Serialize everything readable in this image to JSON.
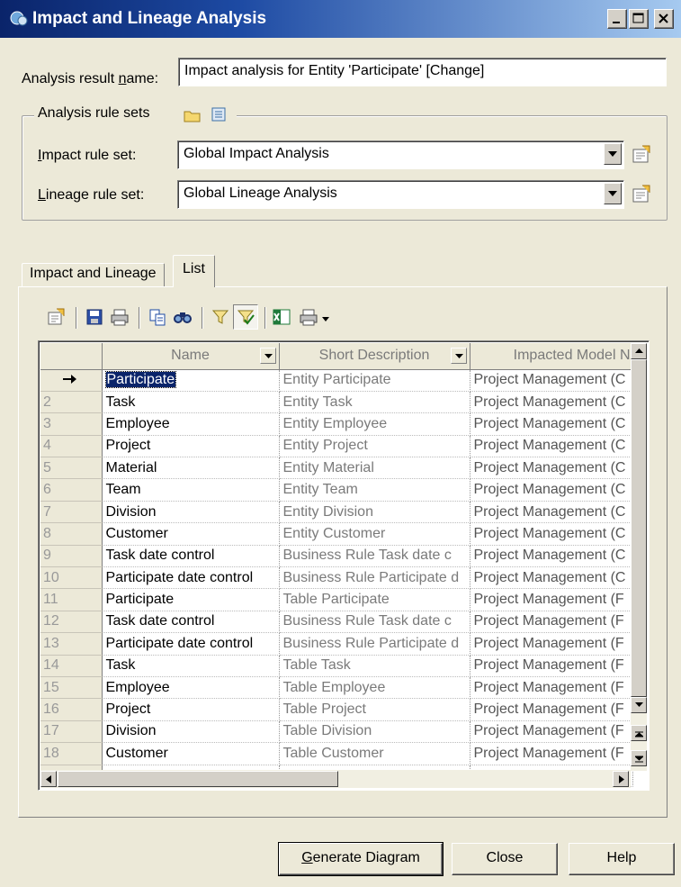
{
  "window": {
    "title": "Impact and Lineage Analysis"
  },
  "analysis": {
    "result_name_label_u": "n",
    "result_name_label_pre": "Analysis result ",
    "result_name_label_post": "ame:",
    "result_name_value": "Impact analysis for Entity 'Participate' [Change]"
  },
  "rule_sets": {
    "legend": "Analysis rule sets",
    "impact_label_u": "I",
    "impact_label_post": "mpact rule set:",
    "impact_value": "Global Impact Analysis",
    "lineage_label_u": "L",
    "lineage_label_post": "ineage rule set:",
    "lineage_value": "Global Lineage Analysis"
  },
  "tabs": [
    {
      "label": "Impact and Lineage"
    },
    {
      "label": "List"
    }
  ],
  "grid": {
    "columns": [
      "Name",
      "Short Description",
      "Impacted Model N"
    ],
    "rows": [
      {
        "num": "",
        "name": "Participate",
        "desc": "Entity Participate",
        "model": "Project Management (C"
      },
      {
        "num": "2",
        "name": "Task",
        "desc": "Entity Task",
        "model": "Project Management (C"
      },
      {
        "num": "3",
        "name": "Employee",
        "desc": "Entity Employee",
        "model": "Project Management (C"
      },
      {
        "num": "4",
        "name": "Project",
        "desc": "Entity Project",
        "model": "Project Management (C"
      },
      {
        "num": "5",
        "name": "Material",
        "desc": "Entity Material",
        "model": "Project Management (C"
      },
      {
        "num": "6",
        "name": "Team",
        "desc": "Entity Team",
        "model": "Project Management (C"
      },
      {
        "num": "7",
        "name": "Division",
        "desc": "Entity Division",
        "model": "Project Management (C"
      },
      {
        "num": "8",
        "name": "Customer",
        "desc": "Entity Customer",
        "model": "Project Management (C"
      },
      {
        "num": "9",
        "name": "Task date control",
        "desc": "Business Rule Task date c",
        "model": "Project Management (C"
      },
      {
        "num": "10",
        "name": "Participate date control",
        "desc": "Business Rule Participate d",
        "model": "Project Management (C"
      },
      {
        "num": "11",
        "name": "Participate",
        "desc": "Table Participate",
        "model": "Project Management (F"
      },
      {
        "num": "12",
        "name": "Task date control",
        "desc": "Business Rule Task date c",
        "model": "Project Management (F"
      },
      {
        "num": "13",
        "name": "Participate date control",
        "desc": "Business Rule Participate d",
        "model": "Project Management (F"
      },
      {
        "num": "14",
        "name": "Task",
        "desc": "Table Task",
        "model": "Project Management (F"
      },
      {
        "num": "15",
        "name": "Employee",
        "desc": "Table Employee",
        "model": "Project Management (F"
      },
      {
        "num": "16",
        "name": "Project",
        "desc": "Table Project",
        "model": "Project Management (F"
      },
      {
        "num": "17",
        "name": "Division",
        "desc": "Table Division",
        "model": "Project Management (F"
      },
      {
        "num": "18",
        "name": "Customer",
        "desc": "Table Customer",
        "model": "Project Management (F"
      }
    ]
  },
  "buttons": {
    "generate_u": "G",
    "generate_post": "enerate Diagram",
    "close": "Close",
    "help": "Help"
  },
  "icons": [
    "app-icon",
    "minimize-icon",
    "maximize-icon",
    "close-icon",
    "folder-icon",
    "model-icon",
    "properties-icon",
    "save-icon",
    "print-icon",
    "copy-icon",
    "find-icon",
    "filter-icon",
    "filter-clear-icon",
    "excel-icon",
    "print-dropdown-icon",
    "current-row-arrow-icon"
  ]
}
